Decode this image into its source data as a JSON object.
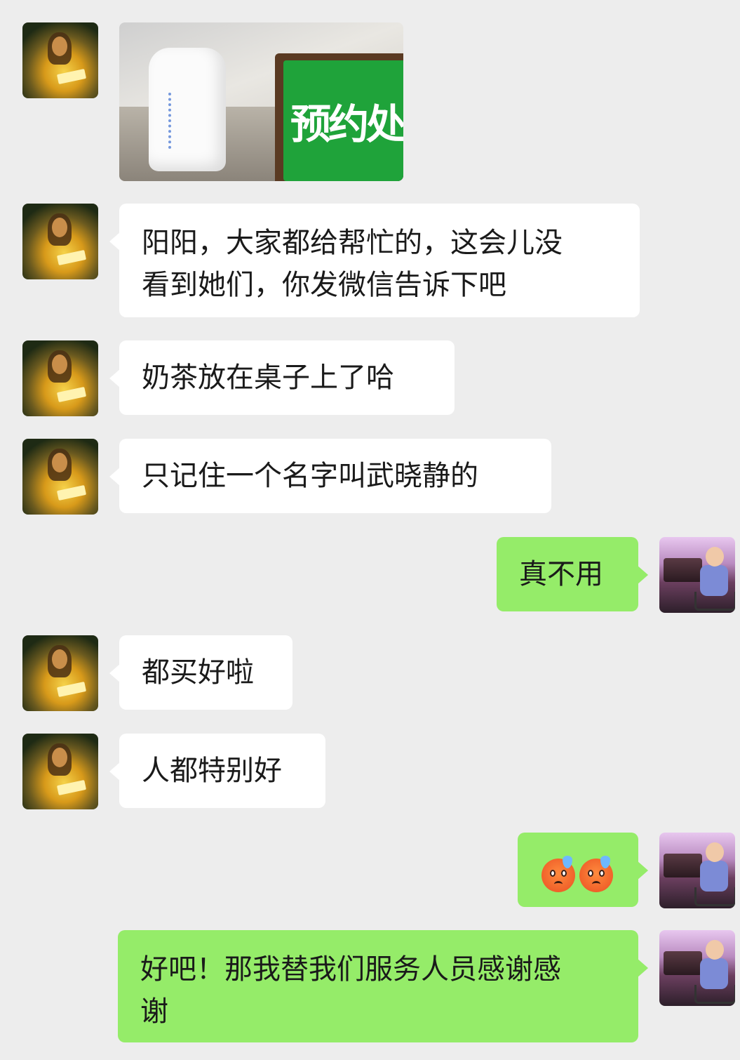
{
  "messages": [
    {
      "side": "left",
      "type": "image",
      "image_text": "预约处"
    },
    {
      "side": "left",
      "type": "text",
      "line1": "阳阳，大家都给帮忙的，这会儿没",
      "line2": "看到她们，你发微信告诉下吧"
    },
    {
      "side": "left",
      "type": "text",
      "text": "奶茶放在桌子上了哈"
    },
    {
      "side": "left",
      "type": "text",
      "text": "只记住一个名字叫武晓静的"
    },
    {
      "side": "right",
      "type": "text",
      "text": "真不用"
    },
    {
      "side": "left",
      "type": "text",
      "text": "都买好啦"
    },
    {
      "side": "left",
      "type": "text",
      "text": "人都特别好"
    },
    {
      "side": "right",
      "type": "emoji",
      "emoji_icon": "anxious-sweat-face-emoji",
      "count": 2
    },
    {
      "side": "right",
      "type": "text",
      "line1": "好吧！那我替我们服务人员感谢感",
      "line2": "谢"
    }
  ],
  "colors": {
    "background": "#ededed",
    "incoming_bubble": "#ffffff",
    "outgoing_bubble": "#95ec69",
    "sign_green": "#1fa33a"
  }
}
